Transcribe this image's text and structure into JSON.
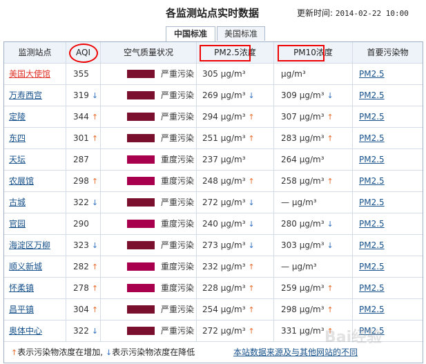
{
  "page": {
    "title": "各监测站点实时数据",
    "update_label": "更新时间:",
    "update_time": "2014-02-22 10:00"
  },
  "tabs": [
    {
      "label": "中国标准",
      "active": true
    },
    {
      "label": "美国标准",
      "active": false
    }
  ],
  "columns": {
    "station": "监测站点",
    "aqi": "AQI",
    "quality": "空气质量状况",
    "pm25": "PM2.5浓度",
    "pm10": "PM10浓度",
    "primary": "首要污染物"
  },
  "colors": {
    "severe": "#7a0f2e",
    "heavy": "#a8004c",
    "up_arrow": "#e86a2a",
    "down_arrow": "#2f6fc1",
    "highlight": "#e0352b"
  },
  "rows": [
    {
      "station": "美国大使馆",
      "aqi": "355",
      "aqi_trend": "",
      "quality": "严重污染",
      "level": "severe",
      "pm25": "305 μg/m³",
      "pm25_trend": "",
      "pm10": " μg/m³",
      "pm10_trend": "",
      "primary": "PM2.5",
      "highlight": true
    },
    {
      "station": "万寿西宫",
      "aqi": "319",
      "aqi_trend": "down",
      "quality": "严重污染",
      "level": "severe",
      "pm25": "269 μg/m³",
      "pm25_trend": "down",
      "pm10": "309 μg/m³",
      "pm10_trend": "down",
      "primary": "PM2.5",
      "highlight": false
    },
    {
      "station": "定陵",
      "aqi": "344",
      "aqi_trend": "up",
      "quality": "严重污染",
      "level": "severe",
      "pm25": "294 μg/m³",
      "pm25_trend": "up",
      "pm10": "307 μg/m³",
      "pm10_trend": "up",
      "primary": "PM2.5",
      "highlight": false
    },
    {
      "station": "东四",
      "aqi": "301",
      "aqi_trend": "up",
      "quality": "严重污染",
      "level": "severe",
      "pm25": "251 μg/m³",
      "pm25_trend": "up",
      "pm10": "283 μg/m³",
      "pm10_trend": "up",
      "primary": "PM2.5",
      "highlight": false
    },
    {
      "station": "天坛",
      "aqi": "287",
      "aqi_trend": "",
      "quality": "重度污染",
      "level": "heavy",
      "pm25": "237 μg/m³",
      "pm25_trend": "",
      "pm10": "264 μg/m³",
      "pm10_trend": "",
      "primary": "PM2.5",
      "highlight": false
    },
    {
      "station": "农展馆",
      "aqi": "298",
      "aqi_trend": "up",
      "quality": "重度污染",
      "level": "heavy",
      "pm25": "248 μg/m³",
      "pm25_trend": "up",
      "pm10": "258 μg/m³",
      "pm10_trend": "up",
      "primary": "PM2.5",
      "highlight": false
    },
    {
      "station": "古城",
      "aqi": "322",
      "aqi_trend": "down",
      "quality": "严重污染",
      "level": "severe",
      "pm25": "272 μg/m³",
      "pm25_trend": "down",
      "pm10": "— μg/m³",
      "pm10_trend": "",
      "primary": "PM2.5",
      "highlight": false
    },
    {
      "station": "官园",
      "aqi": "290",
      "aqi_trend": "",
      "quality": "重度污染",
      "level": "heavy",
      "pm25": "240 μg/m³",
      "pm25_trend": "down",
      "pm10": "280 μg/m³",
      "pm10_trend": "down",
      "primary": "PM2.5",
      "highlight": false
    },
    {
      "station": "海淀区万柳",
      "aqi": "323",
      "aqi_trend": "down",
      "quality": "严重污染",
      "level": "severe",
      "pm25": "273 μg/m³",
      "pm25_trend": "down",
      "pm10": "303 μg/m³",
      "pm10_trend": "down",
      "primary": "PM2.5",
      "highlight": false
    },
    {
      "station": "顺义新城",
      "aqi": "282",
      "aqi_trend": "up",
      "quality": "重度污染",
      "level": "heavy",
      "pm25": "232 μg/m³",
      "pm25_trend": "up",
      "pm10": "— μg/m³",
      "pm10_trend": "",
      "primary": "PM2.5",
      "highlight": false
    },
    {
      "station": "怀柔镇",
      "aqi": "278",
      "aqi_trend": "up",
      "quality": "重度污染",
      "level": "heavy",
      "pm25": "228 μg/m³",
      "pm25_trend": "up",
      "pm10": "259 μg/m³",
      "pm10_trend": "up",
      "primary": "PM2.5",
      "highlight": false
    },
    {
      "station": "昌平镇",
      "aqi": "304",
      "aqi_trend": "up",
      "quality": "严重污染",
      "level": "severe",
      "pm25": "254 μg/m³",
      "pm25_trend": "up",
      "pm10": "298 μg/m³",
      "pm10_trend": "up",
      "primary": "PM2.5",
      "highlight": false
    },
    {
      "station": "奥体中心",
      "aqi": "322",
      "aqi_trend": "down",
      "quality": "严重污染",
      "level": "severe",
      "pm25": "272 μg/m³",
      "pm25_trend": "up",
      "pm10": "331 μg/m³",
      "pm10_trend": "up",
      "primary": "PM2.5",
      "highlight": false
    }
  ],
  "footer": {
    "legend_up": "表示污染物浓度在增加,",
    "legend_down": "表示污染物浓度在降低",
    "source_link": "本站数据来源及与其他网站的不同"
  },
  "watermark": "Bai经验"
}
